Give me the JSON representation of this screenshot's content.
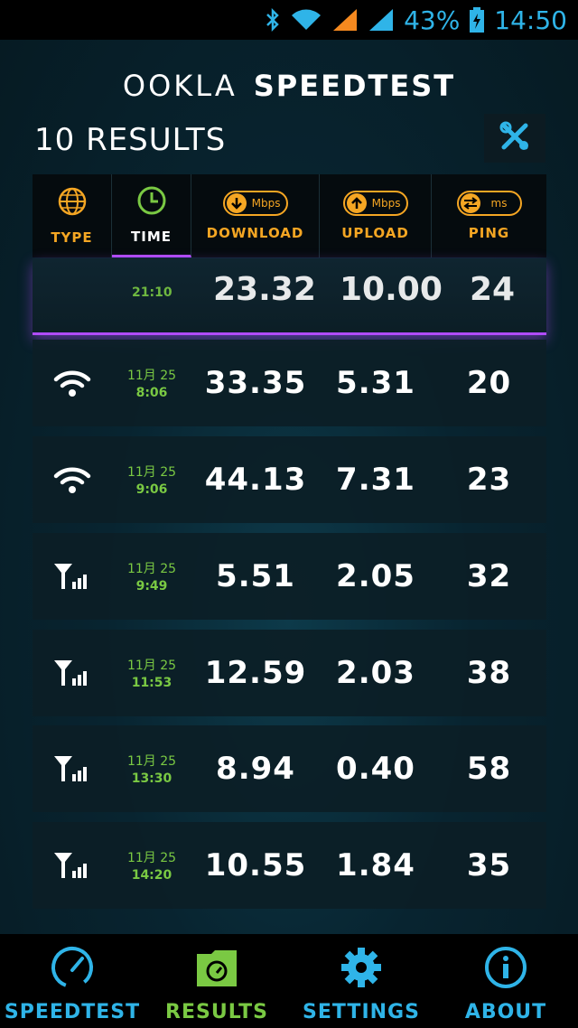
{
  "status": {
    "battery": "43%",
    "time": "14:50",
    "icons": [
      "bluetooth-icon",
      "wifi-icon",
      "signal-icon-1",
      "signal-icon-2",
      "battery-icon"
    ]
  },
  "header": {
    "brand": "OOKLA",
    "product": "SPEEDTEST"
  },
  "results_title": "10 RESULTS",
  "columns": {
    "type": "TYPE",
    "time": "TIME",
    "download": "DOWNLOAD",
    "download_unit": "Mbps",
    "upload": "UPLOAD",
    "upload_unit": "Mbps",
    "ping": "PING",
    "ping_unit": "ms",
    "active": "time"
  },
  "partial_row": {
    "time": "21:10",
    "download": "23.32",
    "upload": "10.00",
    "ping": "24"
  },
  "rows": [
    {
      "type": "wifi",
      "date": "11月 25",
      "time": "8:06",
      "download": "33.35",
      "upload": "5.31",
      "ping": "20"
    },
    {
      "type": "wifi",
      "date": "11月 25",
      "time": "9:06",
      "download": "44.13",
      "upload": "7.31",
      "ping": "23"
    },
    {
      "type": "cell",
      "date": "11月 25",
      "time": "9:49",
      "download": "5.51",
      "upload": "2.05",
      "ping": "32"
    },
    {
      "type": "cell",
      "date": "11月 25",
      "time": "11:53",
      "download": "12.59",
      "upload": "2.03",
      "ping": "38"
    },
    {
      "type": "cell",
      "date": "11月 25",
      "time": "13:30",
      "download": "8.94",
      "upload": "0.40",
      "ping": "58"
    },
    {
      "type": "cell",
      "date": "11月 25",
      "time": "14:20",
      "download": "10.55",
      "upload": "1.84",
      "ping": "35"
    }
  ],
  "nav": [
    {
      "label": "SPEEDTEST",
      "icon": "speedometer-icon"
    },
    {
      "label": "RESULTS",
      "icon": "results-folder-icon",
      "active": true
    },
    {
      "label": "SETTINGS",
      "icon": "gear-icon"
    },
    {
      "label": "ABOUT",
      "icon": "info-icon"
    }
  ],
  "colors": {
    "accent_blue": "#2fb4e8",
    "accent_orange": "#f5a623",
    "accent_green": "#7ac943",
    "accent_purple": "#b04cff"
  }
}
